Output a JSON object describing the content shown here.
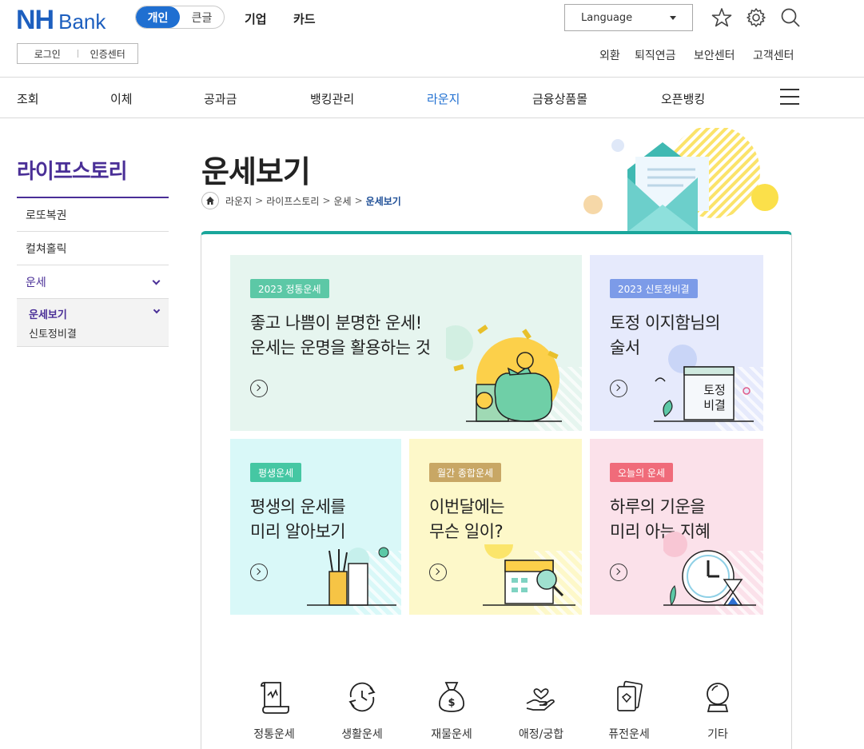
{
  "header": {
    "logo_nh": "NH",
    "logo_bank": "Bank",
    "segment": [
      "개인",
      "큰글"
    ],
    "top_nav": [
      "기업",
      "카드"
    ],
    "login": "로그인",
    "cert_center": "인증센터",
    "language": "Language",
    "util_links": [
      "외환",
      "퇴직연금",
      "보안센터",
      "고객센터"
    ]
  },
  "gnb": [
    "조회",
    "이체",
    "공과금",
    "뱅킹관리",
    "라운지",
    "금융상품몰",
    "오픈뱅킹"
  ],
  "sidebar": {
    "title": "라이프스토리",
    "items": [
      "로또복권",
      "컬쳐홀릭",
      "운세"
    ],
    "sub_active": "운세보기",
    "sub_item": "신토정비결"
  },
  "page": {
    "title": "운세보기",
    "breadcrumb": [
      "라운지",
      "라이프스토리",
      "운세",
      "운세보기"
    ]
  },
  "cards": [
    {
      "badge": "2023 정통운세",
      "text": "좋고 나쁨이 분명한 운세!\n운세는 운명을 활용하는 것",
      "color": "#e6f5ef",
      "badge_color": "#5cc8a6"
    },
    {
      "badge": "2023 신토정비결",
      "text": "토정 이지함님의\n술서",
      "color": "#e6eafc",
      "badge_color": "#7c9be8",
      "book_label": "토정\n비결"
    },
    {
      "badge": "평생운세",
      "text": "평생의 운세를\n미리 알아보기",
      "color": "#d9f8f8",
      "badge_color": "#45c7a3"
    },
    {
      "badge": "월간 종합운세",
      "text": "이번달에는\n무슨 일이?",
      "color": "#fdf8c9",
      "badge_color": "#c8a765"
    },
    {
      "badge": "오늘의 운세",
      "text": "하루의 기운을\n미리 아는 지혜",
      "color": "#fbe1ea",
      "badge_color": "#f06b7a"
    }
  ],
  "categories": [
    {
      "label": "정통운세",
      "icon": "scroll-icon"
    },
    {
      "label": "생활운세",
      "icon": "clock-cycle-icon"
    },
    {
      "label": "재물운세",
      "icon": "money-bag-icon"
    },
    {
      "label": "애정/궁합",
      "icon": "heart-hand-icon"
    },
    {
      "label": "퓨전운세",
      "icon": "cards-icon"
    },
    {
      "label": "기타",
      "icon": "crystal-ball-icon"
    }
  ]
}
